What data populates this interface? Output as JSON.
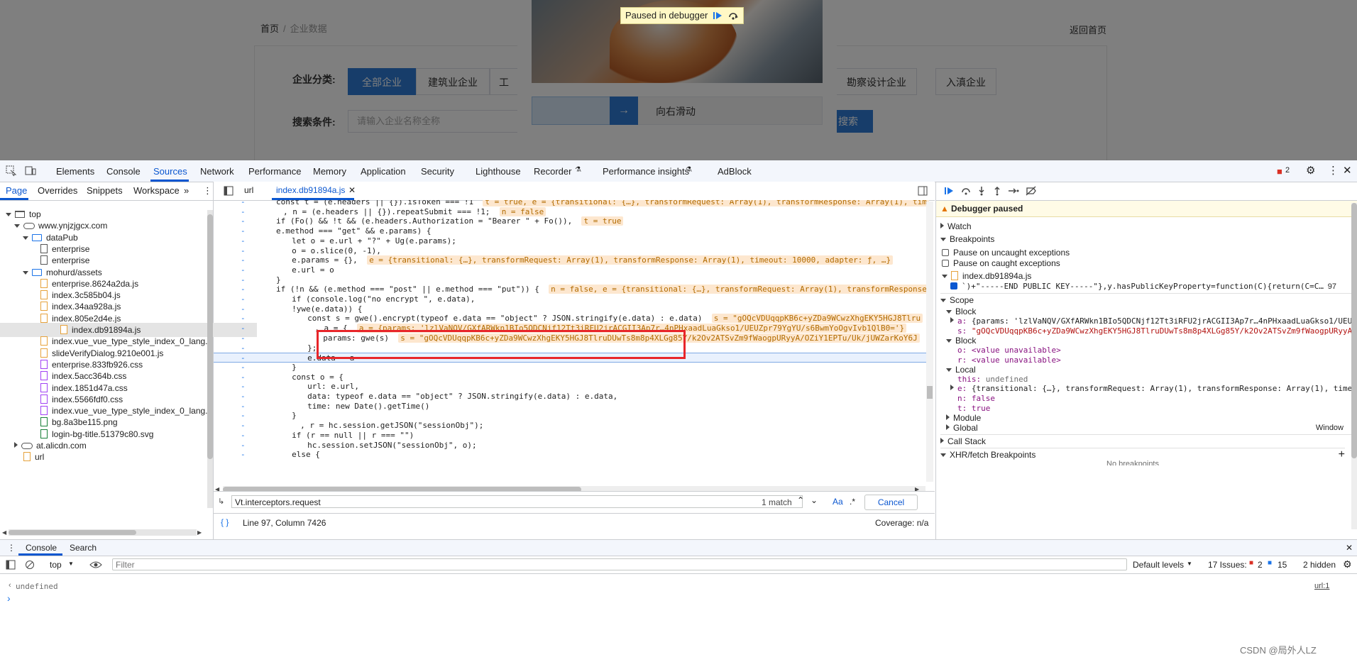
{
  "webpage": {
    "breadcrumb_home": "首页",
    "breadcrumb_sep": "/",
    "breadcrumb_current": "企业数据",
    "back_link": "返回首页",
    "category_label": "企业分类:",
    "categories": [
      "全部企业",
      "建筑业企业",
      "工",
      "勘察设计企业",
      "入滇企业"
    ],
    "search_label": "搜索条件:",
    "search_placeholder": "请输入企业名称全称",
    "search_button": "搜索",
    "paused_badge": "Paused in debugger",
    "slider_text": "向右滑动",
    "slider_handle": "→"
  },
  "devtools": {
    "tabs": [
      "Elements",
      "Console",
      "Sources",
      "Network",
      "Performance",
      "Memory",
      "Application",
      "Security",
      "Lighthouse",
      "Recorder",
      "Performance insights",
      "AdBlock"
    ],
    "error_count": "2",
    "navigator_tabs": [
      "Page",
      "Overrides",
      "Snippets",
      "Workspace"
    ],
    "more_tabs": "»",
    "tree": [
      {
        "label": "top",
        "kind": "frame",
        "depth": 0,
        "open": true
      },
      {
        "label": "www.ynjzjgcx.com",
        "kind": "cloud",
        "depth": 1,
        "open": true
      },
      {
        "label": "dataPub",
        "kind": "folder",
        "depth": 2,
        "open": true
      },
      {
        "label": "enterprise",
        "kind": "file-white",
        "depth": 3
      },
      {
        "label": "enterprise",
        "kind": "file-white",
        "depth": 3
      },
      {
        "label": "mohurd/assets",
        "kind": "folder",
        "depth": 2,
        "open": true
      },
      {
        "label": "enterprise.8624a2da.js",
        "kind": "file-js",
        "depth": 3
      },
      {
        "label": "index.3c585b04.js",
        "kind": "file-js",
        "depth": 3
      },
      {
        "label": "index.34aa928a.js",
        "kind": "file-js",
        "depth": 3
      },
      {
        "label": "index.805e2d4e.js",
        "kind": "file-js",
        "depth": 3
      },
      {
        "label": "index.db91894a.js",
        "kind": "file-js",
        "depth": 3,
        "selected": true
      },
      {
        "label": "index.vue_vue_type_style_index_0_lang.5",
        "kind": "file-js",
        "depth": 3
      },
      {
        "label": "slideVerifyDialog.9210e001.js",
        "kind": "file-js",
        "depth": 3
      },
      {
        "label": "enterprise.833fb926.css",
        "kind": "file-css",
        "depth": 3
      },
      {
        "label": "index.5acc364b.css",
        "kind": "file-css",
        "depth": 3
      },
      {
        "label": "index.1851d47a.css",
        "kind": "file-css",
        "depth": 3
      },
      {
        "label": "index.5566fdf0.css",
        "kind": "file-css",
        "depth": 3
      },
      {
        "label": "index.vue_vue_type_style_index_0_lang.0",
        "kind": "file-css",
        "depth": 3
      },
      {
        "label": "bg.8a3be115.png",
        "kind": "file-img",
        "depth": 3
      },
      {
        "label": "login-bg-title.51379c80.svg",
        "kind": "file-img",
        "depth": 3
      },
      {
        "label": "at.alicdn.com",
        "kind": "cloud",
        "depth": 1,
        "open": false
      },
      {
        "label": "url",
        "kind": "file-js",
        "depth": 1
      }
    ],
    "editor_tabs": [
      "url",
      "index.db91894a.js"
    ],
    "code_lines": [
      [
        "const t = (e.headers || {}).isToken === !1",
        "t = true, e = {transitional: {…}, transformRequest: Array(1), transformResponse: Array(1), tim"
      ],
      [
        "  , n = (e.headers || {}).repeatSubmit === !1;",
        "n = false"
      ],
      [
        "if (Fo() && !t && (e.headers.Authorization = \"Bearer \" + Fo()),",
        "t = true"
      ],
      [
        "e.method === \"get\" && e.params) {",
        ""
      ],
      [
        "    let o = e.url + \"?\" + Ug(e.params);",
        ""
      ],
      [
        "    o = o.slice(0, -1),",
        ""
      ],
      [
        "    e.params = {},",
        "e = {transitional: {…}, transformRequest: Array(1), transformResponse: Array(1), timeout: 10000, adapter: ƒ, …}"
      ],
      [
        "    e.url = o",
        ""
      ],
      [
        "}",
        ""
      ],
      [
        "if (!n && (e.method === \"post\" || e.method === \"put\")) {",
        "n = false, e = {transitional: {…}, transformRequest: Array(1), transformResponse"
      ],
      [
        "    if (console.log(\"no encrypt \", e.data),",
        ""
      ],
      [
        "    !ywe(e.data)) {",
        ""
      ],
      [
        "        const s = gwe().encrypt(typeof e.data == \"object\" ? JSON.stringify(e.data) : e.data)",
        "s = \"gOQcVDUqqpKB6c+yZDa9WCwzXhgEKY5HGJ8Tlru"
      ],
      [
        "          , a = {",
        "a = {params: 'lzlVaNQV/GXfARWkn1BIo5QDCNjf12Tt3iRFU2jrACGII3Ap7r…4nPHxaadLuaGkso1/UEUZpr79YgYU/s6BwmYoOgvIvb1QlB0='}"
      ],
      [
        "            params: gwe(s)",
        "s = \"gOQcVDUqqpKB6c+yZDa9WCwzXhgEKY5HGJ8TlruDUwTs8m8p4XLGg85Y/k2Ov2ATSvZm9fWaogpURyyA/OZiY1EPTu/Uk/jUWZarKoY6J"
      ],
      [
        "        };",
        ""
      ],
      [
        "        e.data = a",
        ""
      ],
      [
        "    }",
        ""
      ],
      [
        "    const o = {",
        ""
      ],
      [
        "        url: e.url,",
        ""
      ],
      [
        "        data: typeof e.data == \"object\" ? JSON.stringify(e.data) : e.data,",
        ""
      ],
      [
        "        time: new Date().getTime()",
        ""
      ],
      [
        "    }",
        ""
      ],
      [
        "      , r = hc.session.getJSON(\"sessionObj\");",
        ""
      ],
      [
        "    if (r == null || r === \"\")",
        ""
      ],
      [
        "        hc.session.setJSON(\"sessionObj\", o);",
        ""
      ],
      [
        "    else {",
        ""
      ]
    ],
    "find_query": "Vt.interceptors.request",
    "find_count": "1 match",
    "find_case": "Aa",
    "find_regex": ".*",
    "find_cancel": "Cancel",
    "status_position": "Line 97, Column 7426",
    "status_coverage": "Coverage: n/a",
    "debugger": {
      "paused_title": "Debugger paused",
      "watch": "Watch",
      "breakpoints": "Breakpoints",
      "pause_uncaught": "Pause on uncaught exceptions",
      "pause_caught": "Pause on caught exceptions",
      "bp_file": "index.db91894a.js",
      "bp_code": "`)+\"-----END PUBLIC KEY-----\"},y.hasPublicKeyProperty=function(C){return(C=C…",
      "bp_line": "97",
      "scope": "Scope",
      "block1": "Block",
      "block1_a_key": "a:",
      "block1_a_val": "{params: 'lzlVaNQV/GXfARWkn1BIo5QDCNjf12Tt3iRFU2jrACGII3Ap7r…4nPHxaadLuaGkso1/UEUZ",
      "block1_s_key": "s:",
      "block1_s_val": "\"gOQcVDUqqpKB6c+yZDa9WCwzXhgEKY5HGJ8TlruDUwTs8m8p4XLGg85Y/k2Ov2ATSvZm9fWaogpURyyA/",
      "block2": "Block",
      "block2_o_key": "o:",
      "block2_o_val": "<value unavailable>",
      "block2_r_key": "r:",
      "block2_r_val": "<value unavailable>",
      "local": "Local",
      "this_key": "this:",
      "this_val": "undefined",
      "e_key": "e:",
      "e_val": "{transitional: {…}, transformRequest: Array(1), transformResponse: Array(1), timeo",
      "n_key": "n:",
      "n_val": "false",
      "t_key": "t:",
      "t_val": "true",
      "module": "Module",
      "global": "Global",
      "global_val": "Window",
      "call_stack": "Call Stack",
      "xhr": "XHR/fetch Breakpoints",
      "xhr_plus": "+",
      "cut_text": "No breakpoints"
    },
    "drawer": {
      "tabs": [
        "Console",
        "Search"
      ],
      "context": "top",
      "filter_placeholder": "Filter",
      "levels": "Default levels",
      "issues_label": "17 Issues:",
      "issues_red": "2",
      "issues_blue": "15",
      "hidden": "2 hidden",
      "output_undefined": "undefined",
      "output_src": "url:1",
      "prompt": "›"
    }
  },
  "watermark": "CSDN @局外人LZ"
}
